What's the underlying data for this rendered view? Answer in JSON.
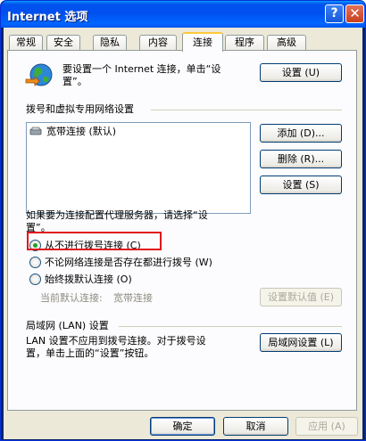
{
  "window": {
    "title": "Internet 选项",
    "help_label": "?",
    "close_label": "✕"
  },
  "tabs": [
    {
      "label": "常规"
    },
    {
      "label": "安全"
    },
    {
      "label": "隐私"
    },
    {
      "label": "内容"
    },
    {
      "label": "连接"
    },
    {
      "label": "程序"
    },
    {
      "label": "高级"
    }
  ],
  "active_tab": "连接",
  "setup": {
    "text_line1": "要设置一个 Internet 连接，单击“设",
    "text_line2": "置”。",
    "button_label": "设置 (U)"
  },
  "dialup": {
    "group_label": "拨号和虚拟专用网络设置",
    "items": [
      {
        "label": "宽带连接 (默认)"
      }
    ],
    "add_label": "添加 (D)...",
    "remove_label": "删除 (R)...",
    "settings_label": "设置 (S)"
  },
  "proxy": {
    "text_line1": "如果要为连接配置代理服务器，请选择“设",
    "text_line2": "置”。",
    "options": [
      {
        "label": "从不进行拨号连接 (C)",
        "checked": true
      },
      {
        "label": "不论网络连接是否存在都进行拨号 (W)",
        "checked": false
      },
      {
        "label": "始终拨默认连接 (O)",
        "checked": false
      }
    ],
    "current_default_label": "当前默认连接:",
    "current_default_value": "宽带连接",
    "set_default_label": "设置默认值 (E)"
  },
  "lan": {
    "group_label": "局域网 (LAN) 设置",
    "text_line1": "LAN 设置不应用到拨号连接。对于拨号设",
    "text_line2": "置，单击上面的“设置”按钮。",
    "button_label": "局域网设置 (L)"
  },
  "footer": {
    "ok_label": "确定",
    "cancel_label": "取消",
    "apply_label": "应用 (A)"
  },
  "colors": {
    "titlebar": "#0053ee",
    "client": "#ece9d8",
    "highlight": "#e0161c",
    "radio_dot": "#21a121"
  }
}
